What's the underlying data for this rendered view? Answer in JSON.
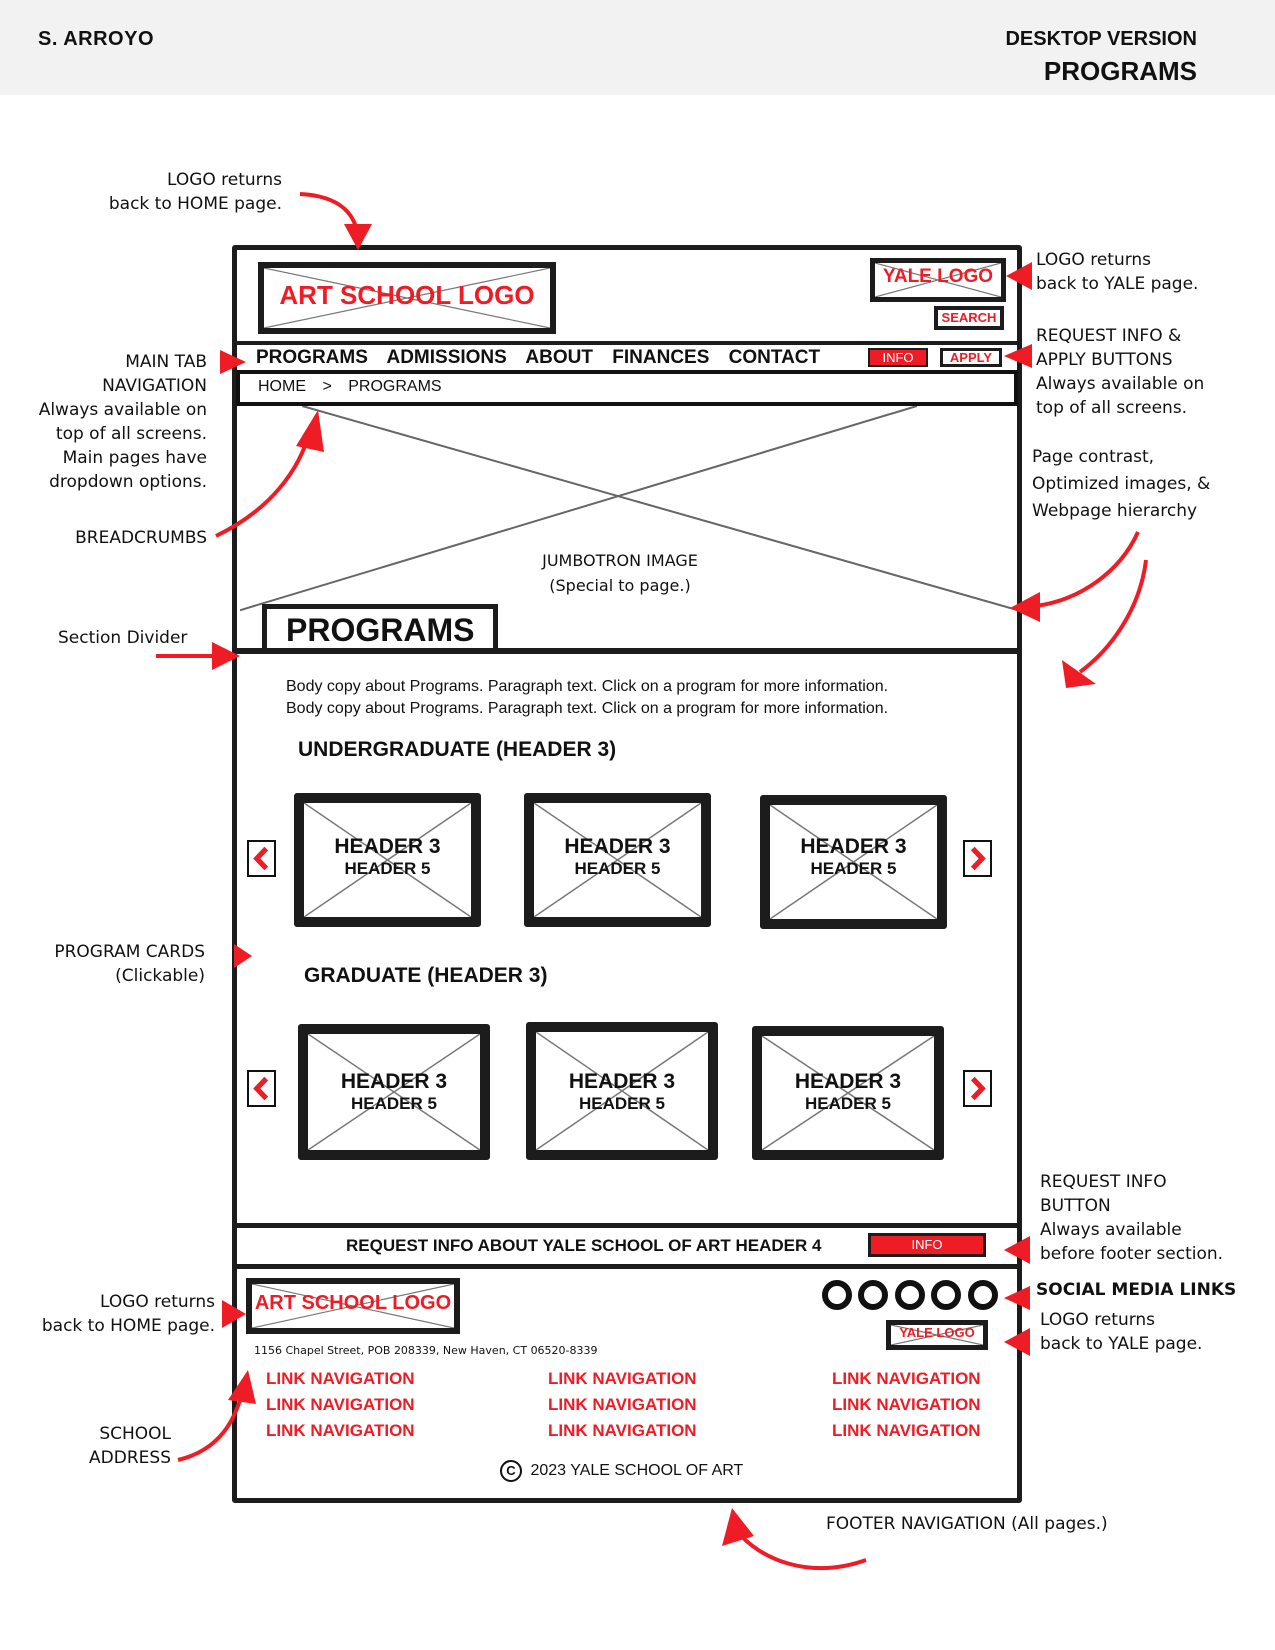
{
  "sheet": {
    "author": "S. ARROYO",
    "version": "DESKTOP VERSION",
    "page": "PROGRAMS"
  },
  "annotations": {
    "logo_home_top": [
      "LOGO returns",
      "back to HOME page."
    ],
    "logo_yale_top": [
      "LOGO returns",
      "back to YALE page."
    ],
    "main_tab_nav": [
      "MAIN TAB",
      "NAVIGATION",
      "Always available on",
      "top of all screens.",
      "Main pages have",
      "dropdown options."
    ],
    "request_apply": [
      "REQUEST INFO &",
      "APPLY BUTTONS",
      "Always available on",
      "top of all screens."
    ],
    "page_contrast": [
      "Page contrast,",
      "Optimized images, &",
      "Webpage hierarchy"
    ],
    "breadcrumbs": "BREADCRUMBS",
    "section_divider": "Section Divider",
    "program_cards": [
      "PROGRAM CARDS",
      "(Clickable)"
    ],
    "request_info_button": [
      "REQUEST INFO",
      "BUTTON",
      "Always available",
      "before footer section."
    ],
    "social_media": "SOCIAL MEDIA LINKS",
    "logo_yale_footer": [
      "LOGO returns",
      "back to YALE page."
    ],
    "logo_home_footer": [
      "LOGO returns",
      "back to HOME page."
    ],
    "school_address": [
      "SCHOOL",
      "ADDRESS"
    ],
    "footer_nav": "FOOTER NAVIGATION (All pages.)"
  },
  "header": {
    "logo_label": "ART SCHOOL LOGO",
    "yale_logo_label": "YALE LOGO",
    "search_label": "SEARCH",
    "nav": [
      "PROGRAMS",
      "ADMISSIONS",
      "ABOUT",
      "FINANCES",
      "CONTACT"
    ],
    "info_label": "INFO",
    "apply_label": "APPLY",
    "breadcrumb": [
      "HOME",
      ">",
      "PROGRAMS"
    ]
  },
  "jumbotron": {
    "label": "JUMBOTRON IMAGE",
    "sublabel": "(Special to page.)"
  },
  "main": {
    "title": "PROGRAMS",
    "body": [
      "Body copy about Programs. Paragraph text. Click on a program for more information.",
      "Body copy about Programs. Paragraph text. Click on a program for more information."
    ],
    "sections": [
      {
        "heading": "UNDERGRADUATE (HEADER 3)",
        "cards": [
          {
            "h3": "HEADER 3",
            "h5": "HEADER 5"
          },
          {
            "h3": "HEADER 3",
            "h5": "HEADER 5"
          },
          {
            "h3": "HEADER 3",
            "h5": "HEADER 5"
          }
        ]
      },
      {
        "heading": "GRADUATE (HEADER 3)",
        "cards": [
          {
            "h3": "HEADER 3",
            "h5": "HEADER 5"
          },
          {
            "h3": "HEADER 3",
            "h5": "HEADER 5"
          },
          {
            "h3": "HEADER 3",
            "h5": "HEADER 5"
          }
        ]
      }
    ]
  },
  "request_info": {
    "text": "REQUEST INFO ABOUT YALE SCHOOL OF ART HEADER 4",
    "button": "INFO"
  },
  "footer": {
    "logo_label": "ART SCHOOL LOGO",
    "yale_logo_label": "YALE LOGO",
    "address": "1156 Chapel Street, POB 208339, New Haven, CT 06520-8339",
    "social_count": 5,
    "link_columns": [
      [
        "LINK NAVIGATION",
        "LINK NAVIGATION",
        "LINK NAVIGATION"
      ],
      [
        "LINK NAVIGATION",
        "LINK NAVIGATION",
        "LINK NAVIGATION"
      ],
      [
        "LINK NAVIGATION",
        "LINK NAVIGATION",
        "LINK NAVIGATION"
      ]
    ],
    "copyright_symbol": "C",
    "copyright": "2023 YALE SCHOOL OF ART"
  },
  "colors": {
    "accent": "#ee1c24",
    "ink": "#1c1c1c",
    "band": "#f2f2f2"
  }
}
